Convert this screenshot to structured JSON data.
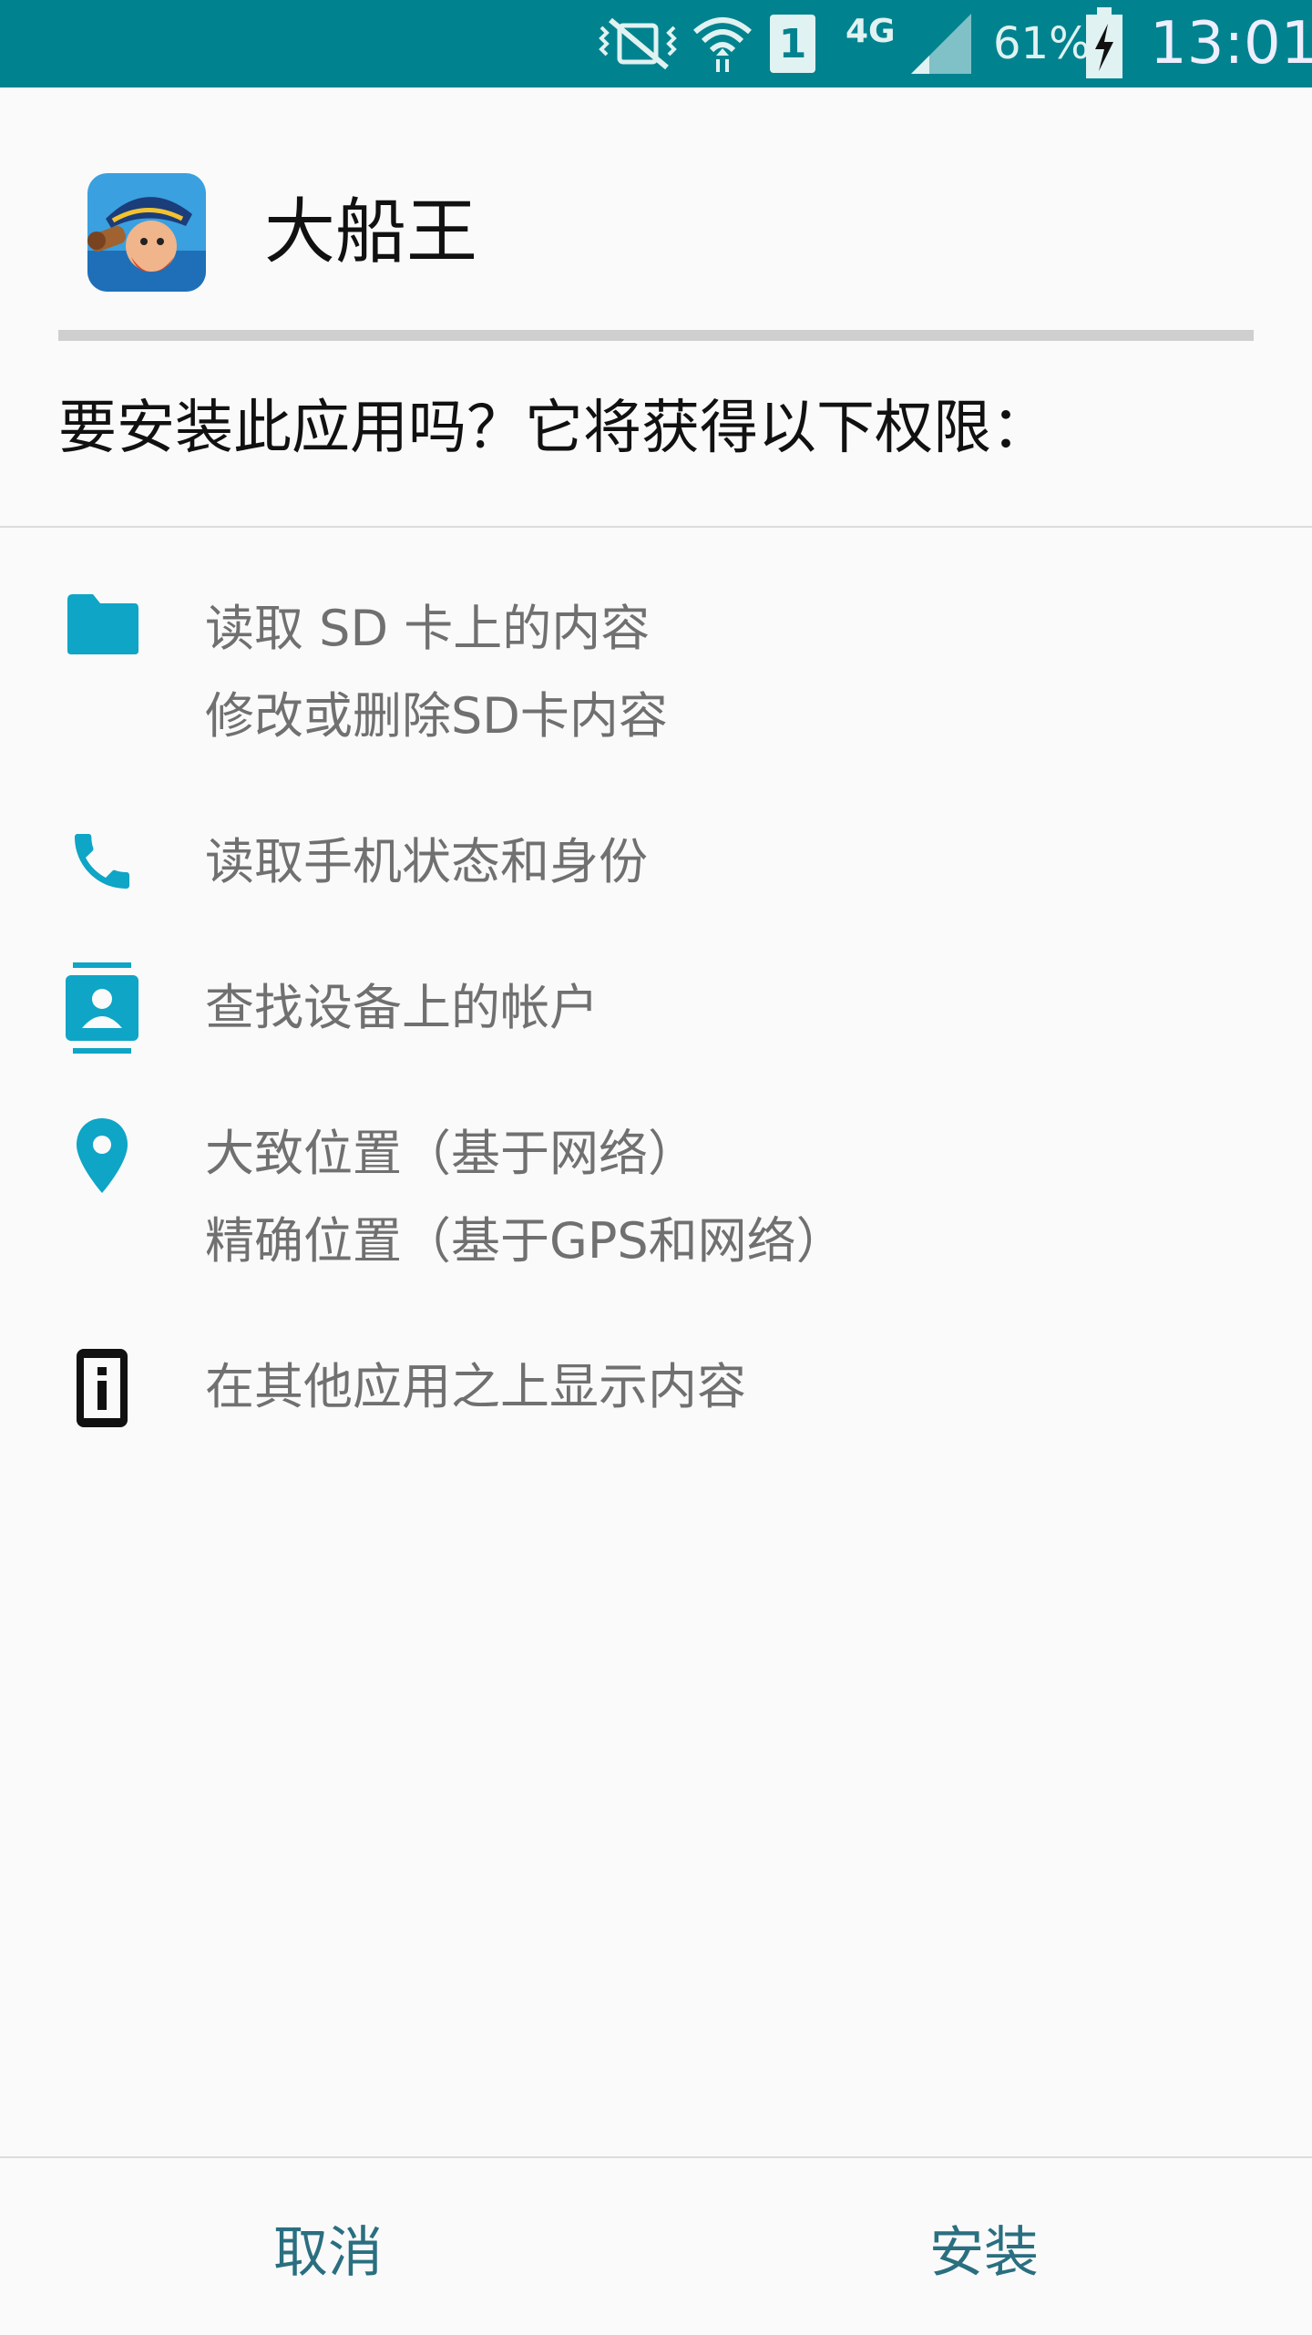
{
  "status_bar": {
    "battery_text": "61%",
    "time": "13:01",
    "network_label": "4G",
    "sim_label": "1",
    "bg_color": "#00838f"
  },
  "header": {
    "app_name": "大船王",
    "app_icon": "pirate-app-icon",
    "question": "要安装此应用吗？它将获得以下权限："
  },
  "permissions": [
    {
      "icon": "folder-icon",
      "lines": [
        "读取 SD 卡上的内容",
        "修改或删除SD卡内容"
      ],
      "icon_color": "#0ea5c6"
    },
    {
      "icon": "phone-icon",
      "lines": [
        "读取手机状态和身份"
      ],
      "icon_color": "#0ea5c6"
    },
    {
      "icon": "contact-card-icon",
      "lines": [
        "查找设备上的帐户"
      ],
      "icon_color": "#0ea5c6"
    },
    {
      "icon": "location-pin-icon",
      "lines": [
        "大致位置（基于网络）",
        "精确位置（基于GPS和网络）"
      ],
      "icon_color": "#0ea5c6"
    },
    {
      "icon": "overlay-info-icon",
      "lines": [
        "在其他应用之上显示内容"
      ],
      "icon_color": "#111111"
    }
  ],
  "buttons": {
    "cancel": "取消",
    "install": "安装",
    "color": "#2a6f80"
  }
}
